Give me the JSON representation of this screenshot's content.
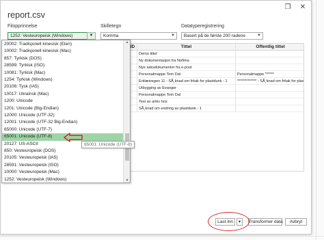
{
  "dialog": {
    "title": "report.csv",
    "close_glyph": "✕",
    "restore_glyph": "❐"
  },
  "options": {
    "origin_label": "Filopprinnelse",
    "origin_value": "1252: Vesteuropeisk (Windows)",
    "delimiter_label": "Skilletegn",
    "delimiter_value": "Komma",
    "detection_label": "Datatyperegistrering",
    "detection_value": "Basert på de første 200 radene"
  },
  "encoding_list": [
    "20002: Tradisjonell kinesisk (Eten)",
    "10002: Tradisjonell kinesisk (Mac)",
    "857: Tyrkisk (DOS)",
    "28599: Tyrkisk (ISO)",
    "10081: Tyrkisk (Mac)",
    "1254: Tyrkisk (Windows)",
    "20106: Tysk (IA5)",
    "10017: Ukrainsk (Mac)",
    "1200: Unicode",
    "1201: Unicode (Big-Endian)",
    "12000: Unicode (UTF-32)",
    "12001: Unicode (UTF-32 Big-Endian)",
    "65000: Unicode (UTF-7)",
    "65001: Unicode (UTF-8)",
    "20127: US-ASCII",
    "850: Vesteuropeisk (DOS)",
    "20105: Vesteuropeisk (IA5)",
    "28591: Vesteuropeisk (ISO)",
    "10000: Vesteuropeisk (Mac)",
    "1252: Vesteuropeisk (Windows)"
  ],
  "selected_index": 13,
  "tooltip": "65001: Unicode (UTF-8)",
  "preview": {
    "columns": [
      "ID",
      "Tittel",
      "Offentlig tittel"
    ],
    "rows": [
      [
        "",
        "Demo tittel",
        ""
      ],
      [
        "",
        "Ny dokumentasjon fra Nofima",
        ""
      ],
      [
        "",
        "Nye saksdokumenter fra e-post",
        ""
      ],
      [
        "",
        "Personalmappe Tom Dal",
        "Personalmappe ******"
      ],
      [
        "",
        "Erklæivegen 11 - SÃ¸knad om fritak for plastdunk - 1",
        "************* - SÃ¸knad om fritak for plastdunk"
      ],
      [
        "",
        "Utbygging av Evanger",
        ""
      ],
      [
        "",
        "Personalmappe Tom Dal",
        ""
      ],
      [
        "",
        "Test av arkiv hos",
        ""
      ],
      [
        "",
        "SÃ¸knad om endring av plastdunk - 1",
        ""
      ]
    ]
  },
  "footer": {
    "load_label": "Last inn",
    "load_menu_glyph": "▾",
    "transform_label": "Transformer data",
    "cancel_label": "Avbryt"
  },
  "colors": {
    "selection": "#9ed4a8",
    "annotation": "#d92525"
  }
}
